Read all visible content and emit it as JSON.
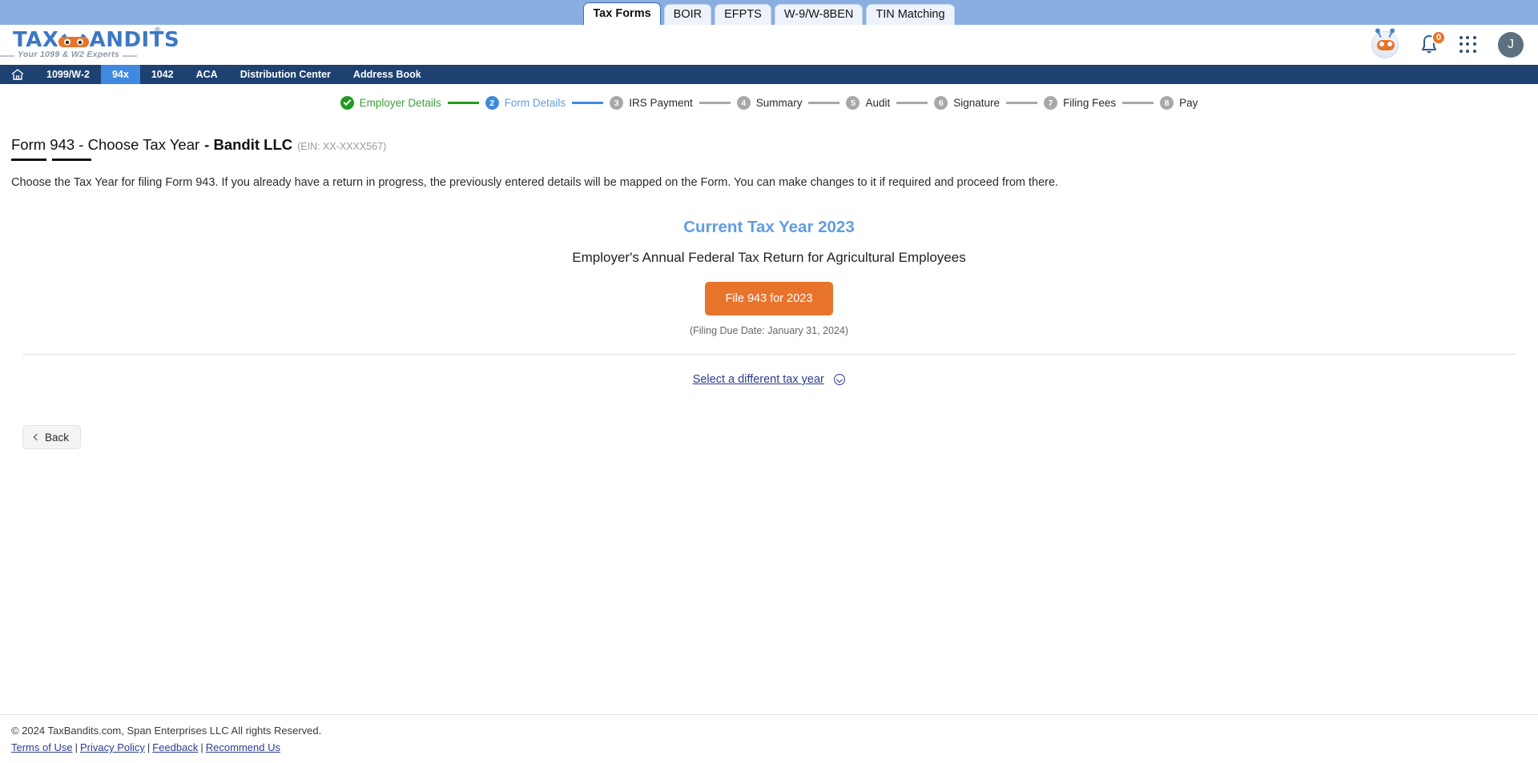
{
  "browser_tabs": [
    {
      "label": "Tax Forms",
      "active": true
    },
    {
      "label": "BOIR",
      "active": false
    },
    {
      "label": "EFPTS",
      "active": false
    },
    {
      "label": "W-9/W-8BEN",
      "active": false
    },
    {
      "label": "TIN Matching",
      "active": false
    }
  ],
  "brand": {
    "name": "TAXBANDITS",
    "name_part1": "TAX",
    "name_part2": "ANDITS",
    "trademark": "®",
    "tagline": "Your 1099 & W2 Experts"
  },
  "header": {
    "notification_count": "0",
    "avatar_initial": "J"
  },
  "nav": {
    "items": [
      {
        "label": "1099/W-2",
        "active": false
      },
      {
        "label": "94x",
        "active": true
      },
      {
        "label": "1042",
        "active": false
      },
      {
        "label": "ACA",
        "active": false
      },
      {
        "label": "Distribution Center",
        "active": false
      },
      {
        "label": "Address Book",
        "active": false
      }
    ]
  },
  "stepper": {
    "steps": [
      {
        "num": "1",
        "label": "Employer Details",
        "state": "done"
      },
      {
        "num": "2",
        "label": "Form Details",
        "state": "current"
      },
      {
        "num": "3",
        "label": "IRS Payment",
        "state": "todo"
      },
      {
        "num": "4",
        "label": "Summary",
        "state": "todo"
      },
      {
        "num": "5",
        "label": "Audit",
        "state": "todo"
      },
      {
        "num": "6",
        "label": "Signature",
        "state": "todo"
      },
      {
        "num": "7",
        "label": "Filing Fees",
        "state": "todo"
      },
      {
        "num": "8",
        "label": "Pay",
        "state": "todo"
      }
    ]
  },
  "page": {
    "title": "Form 943 - Choose Tax Year",
    "company": "- Bandit LLC",
    "ein": "(EIN: XX-XXXX567)",
    "description": "Choose the Tax Year for filing Form 943. If you already have a return in progress, the previously entered details will be mapped on the Form. You can make changes to it if required and proceed from there.",
    "card": {
      "year_heading": "Current Tax Year 2023",
      "form_description": "Employer's Annual Federal Tax Return for Agricultural Employees",
      "file_button": "File 943 for 2023",
      "due_date": "(Filing Due Date: January 31, 2024)"
    },
    "select_different_year": "Select a different tax year",
    "back_button": "Back"
  },
  "footer": {
    "copyright": "© 2024 TaxBandits.com, Span Enterprises LLC All rights Reserved.",
    "links": [
      "Terms of Use",
      "Privacy Policy",
      "Feedback",
      "Recommend Us"
    ],
    "separator": "|"
  },
  "colors": {
    "brand_blue": "#3d78c4",
    "nav_navy": "#1d4272",
    "accent_orange": "#e8742c",
    "active_blue": "#3f8ae0",
    "done_green": "#1f9b1f",
    "link_indigo": "#2b3d8f"
  }
}
